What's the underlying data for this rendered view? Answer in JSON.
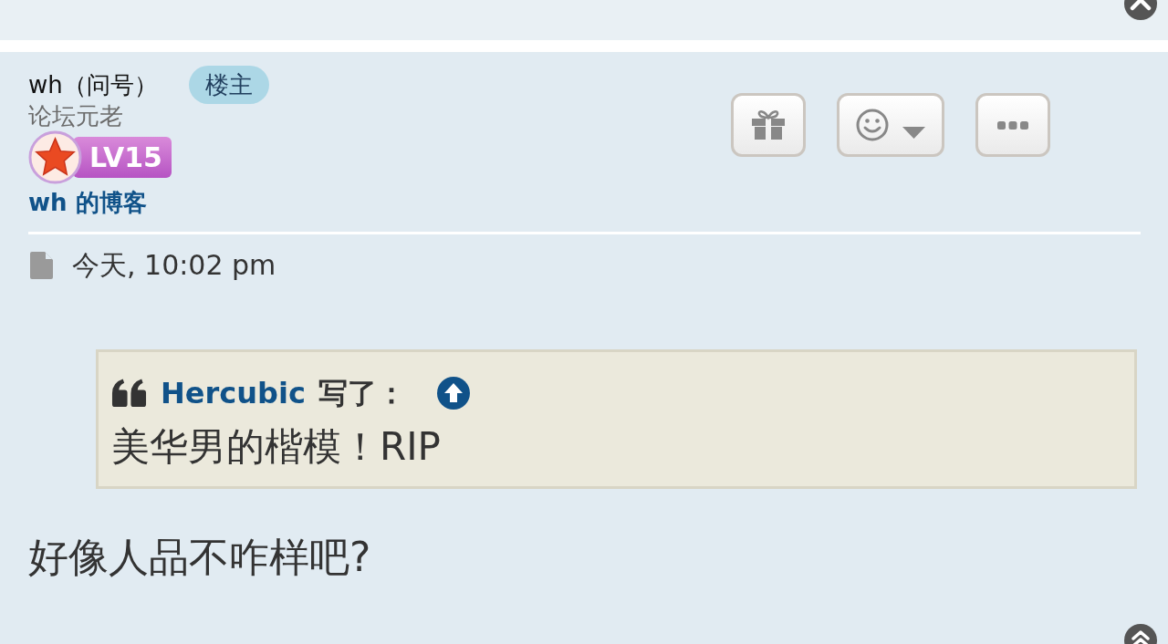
{
  "post": {
    "author": {
      "name": "wh（问号）",
      "badge": "楼主",
      "rank": "论坛元老",
      "level": "LV15",
      "blog_link": "wh 的博客"
    },
    "actions": [
      {
        "kind": "gift"
      },
      {
        "kind": "reaction"
      },
      {
        "kind": "more"
      }
    ],
    "date": "今天, 10:02 pm",
    "quote": {
      "author": "Hercubic",
      "verb": "写了：",
      "text": "美华男的楷模！RIP"
    },
    "body": "好像人品不咋样吧?"
  }
}
